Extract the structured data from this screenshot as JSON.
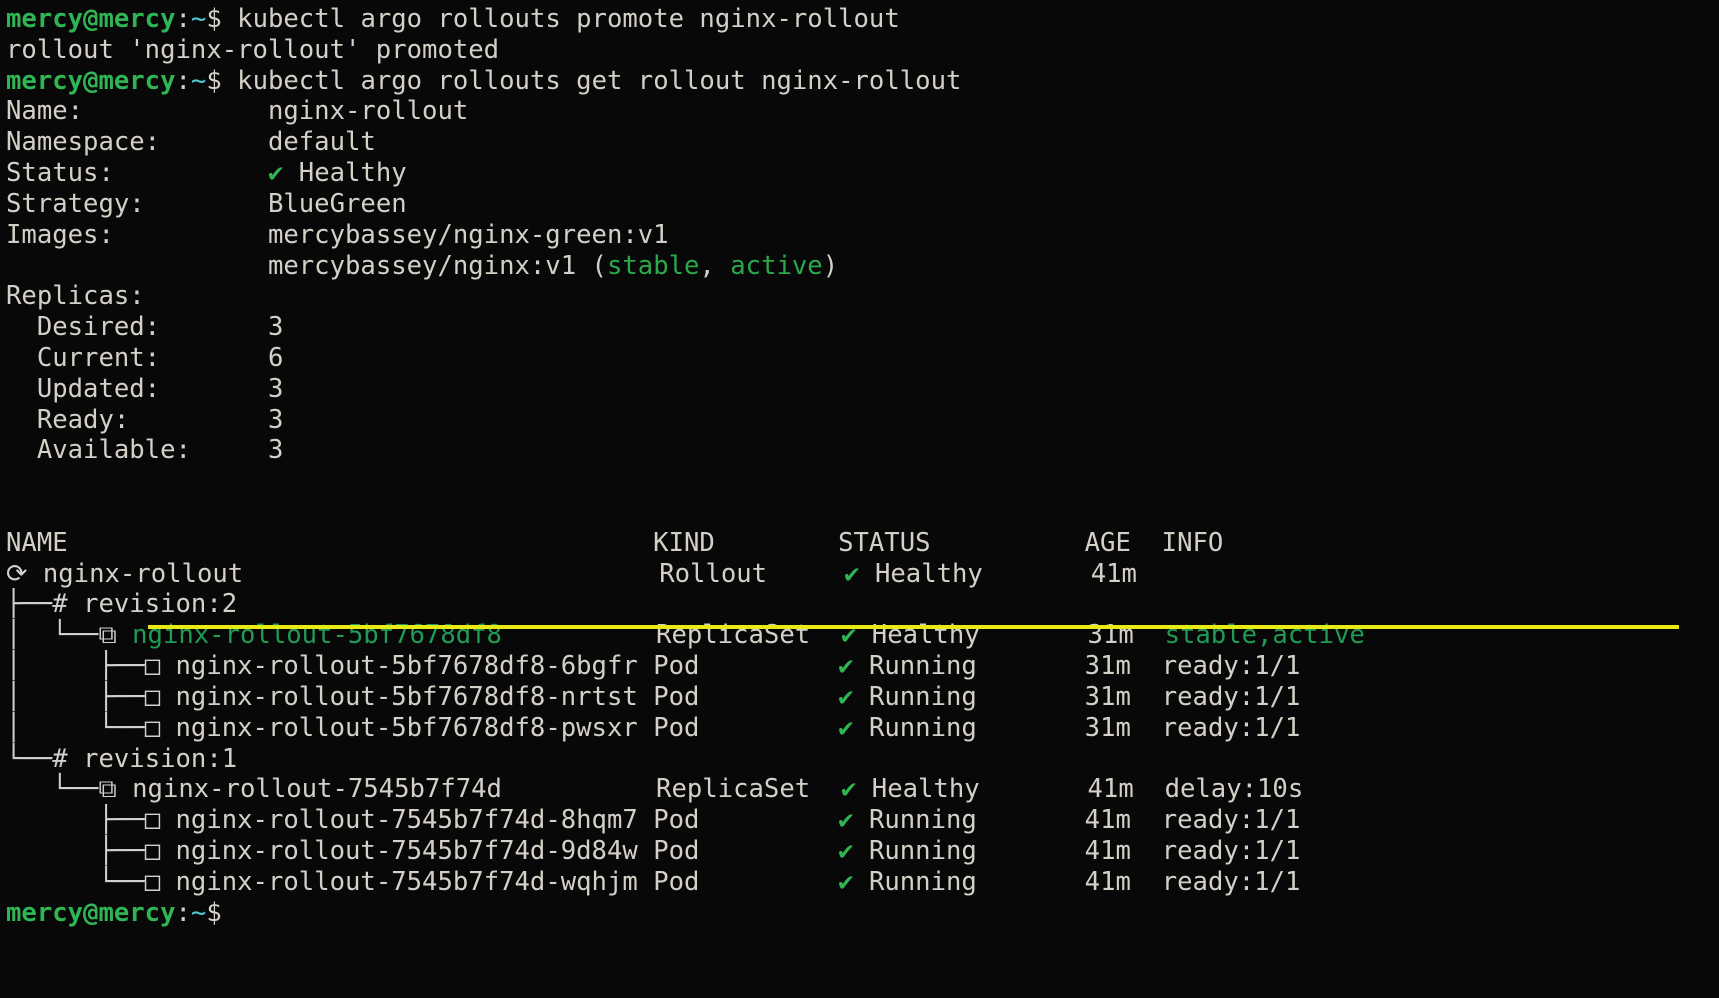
{
  "terminal": {
    "background_color": "#080808",
    "foreground_color": "#d4d0c8",
    "prompt_user_color": "#2fb554",
    "accent_green": "#1f9b54",
    "highlight_color": "#e8ea16",
    "user_host": "mercy@mercy",
    "path": "~",
    "prompt_symbol": "$"
  },
  "session": {
    "commands": [
      {
        "command": "kubectl argo rollouts promote nginx-rollout",
        "output": "rollout 'nginx-rollout' promoted"
      },
      {
        "command": "kubectl argo rollouts get rollout nginx-rollout"
      }
    ],
    "final_prompt": true
  },
  "rollout": {
    "fields": [
      {
        "label": "Name:",
        "value": "nginx-rollout"
      },
      {
        "label": "Namespace:",
        "value": "default"
      },
      {
        "label": "Status:",
        "value": "Healthy",
        "icon": "check-icon",
        "status_ok": true
      },
      {
        "label": "Strategy:",
        "value": "BlueGreen"
      }
    ],
    "images_label": "Images:",
    "images": [
      {
        "name": "mercybassey/nginx-green:v1",
        "tags": []
      },
      {
        "name": "mercybassey/nginx:v1",
        "tags": [
          "stable",
          "active"
        ]
      }
    ],
    "replicas_label": "Replicas:",
    "replicas": [
      {
        "label": "Desired:",
        "value": "3"
      },
      {
        "label": "Current:",
        "value": "6"
      },
      {
        "label": "Updated:",
        "value": "3"
      },
      {
        "label": "Ready:",
        "value": "3"
      },
      {
        "label": "Available:",
        "value": "3"
      }
    ]
  },
  "tree_table": {
    "columns": [
      "NAME",
      "KIND",
      "STATUS",
      "AGE",
      "INFO"
    ],
    "rows": [
      {
        "icon": "rollout-icon",
        "glyph": "⟳",
        "name": "nginx-rollout",
        "kind": "Rollout",
        "status": "Healthy",
        "status_icon": "check-icon",
        "age": "41m",
        "info": "",
        "depth": 0,
        "highlighted": false,
        "name_green": false
      },
      {
        "icon": "revision-icon",
        "glyph": "#",
        "name": "revision:2",
        "kind": "",
        "status": "",
        "status_icon": "",
        "age": "",
        "info": "",
        "depth": 1,
        "highlighted": false,
        "name_green": false
      },
      {
        "icon": "replicaset-icon",
        "glyph": "⧉",
        "name": "nginx-rollout-5bf7678df8",
        "kind": "ReplicaSet",
        "status": "Healthy",
        "status_icon": "check-icon",
        "age": "31m",
        "info": "stable,active",
        "depth": 2,
        "highlighted": true,
        "name_green": true,
        "info_green": true
      },
      {
        "icon": "pod-icon",
        "glyph": "□",
        "name": "nginx-rollout-5bf7678df8-6bgfr",
        "kind": "Pod",
        "status": "Running",
        "status_icon": "check-icon",
        "age": "31m",
        "info": "ready:1/1",
        "depth": 3,
        "highlighted": false,
        "name_green": false
      },
      {
        "icon": "pod-icon",
        "glyph": "□",
        "name": "nginx-rollout-5bf7678df8-nrtst",
        "kind": "Pod",
        "status": "Running",
        "status_icon": "check-icon",
        "age": "31m",
        "info": "ready:1/1",
        "depth": 3,
        "highlighted": false,
        "name_green": false
      },
      {
        "icon": "pod-icon",
        "glyph": "□",
        "name": "nginx-rollout-5bf7678df8-pwsxr",
        "kind": "Pod",
        "status": "Running",
        "status_icon": "check-icon",
        "age": "31m",
        "info": "ready:1/1",
        "depth": 3,
        "highlighted": false,
        "name_green": false
      },
      {
        "icon": "revision-icon",
        "glyph": "#",
        "name": "revision:1",
        "kind": "",
        "status": "",
        "status_icon": "",
        "age": "",
        "info": "",
        "depth": 1,
        "highlighted": false,
        "name_green": false
      },
      {
        "icon": "replicaset-icon",
        "glyph": "⧉",
        "name": "nginx-rollout-7545b7f74d",
        "kind": "ReplicaSet",
        "status": "Healthy",
        "status_icon": "check-icon",
        "age": "41m",
        "info": "delay:10s",
        "depth": 2,
        "highlighted": false,
        "name_green": false
      },
      {
        "icon": "pod-icon",
        "glyph": "□",
        "name": "nginx-rollout-7545b7f74d-8hqm7",
        "kind": "Pod",
        "status": "Running",
        "status_icon": "check-icon",
        "age": "41m",
        "info": "ready:1/1",
        "depth": 3,
        "highlighted": false,
        "name_green": false
      },
      {
        "icon": "pod-icon",
        "glyph": "□",
        "name": "nginx-rollout-7545b7f74d-9d84w",
        "kind": "Pod",
        "status": "Running",
        "status_icon": "check-icon",
        "age": "41m",
        "info": "ready:1/1",
        "depth": 3,
        "highlighted": false,
        "name_green": false
      },
      {
        "icon": "pod-icon",
        "glyph": "□",
        "name": "nginx-rollout-7545b7f74d-wqhjm",
        "kind": "Pod",
        "status": "Running",
        "status_icon": "check-icon",
        "age": "41m",
        "info": "ready:1/1",
        "depth": 3,
        "highlighted": false,
        "name_green": false
      }
    ]
  }
}
